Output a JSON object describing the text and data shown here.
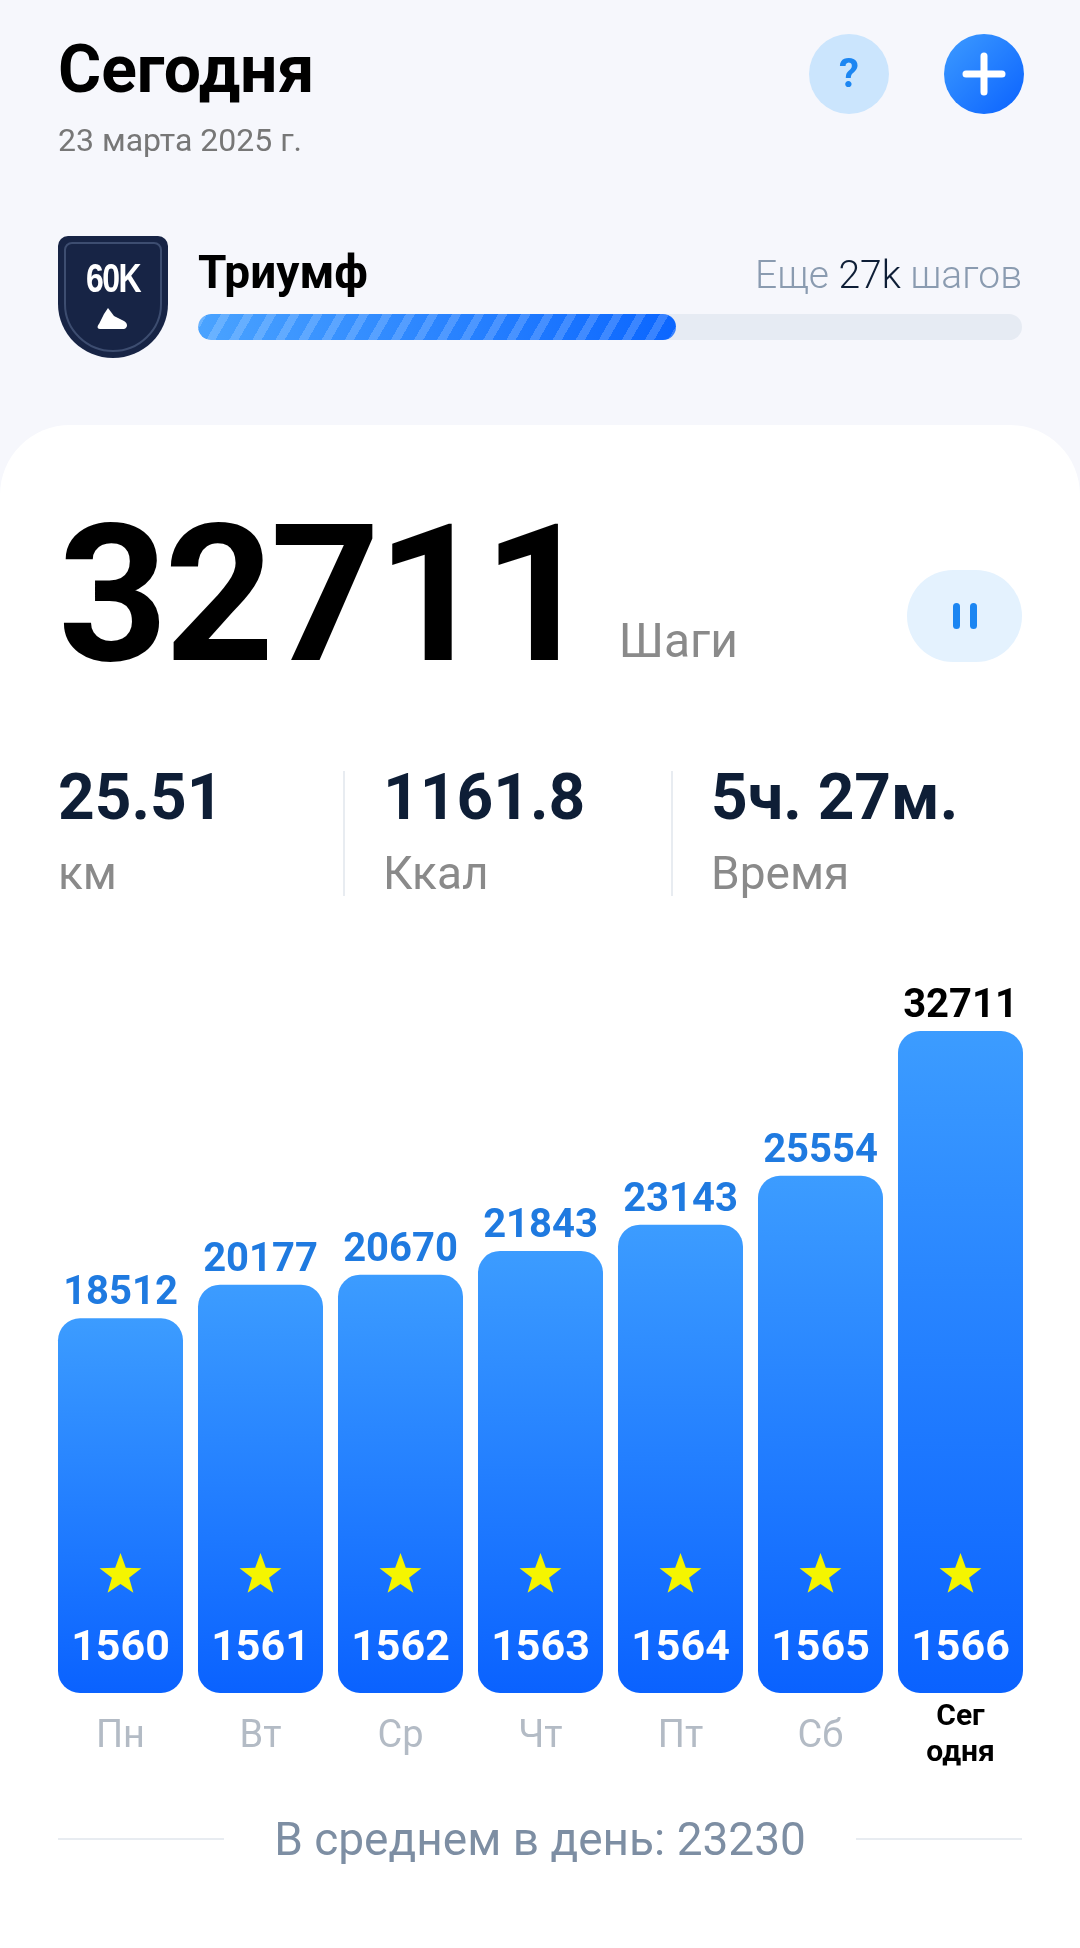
{
  "header": {
    "title": "Сегодня",
    "date": "23 марта 2025 г.",
    "help_label": "?"
  },
  "achievement": {
    "badge": "60K",
    "title": "Триумф",
    "remaining_prefix": "Еще",
    "remaining_value": "27k",
    "remaining_suffix": "шагов",
    "level": 0.58
  },
  "steps": {
    "value": "32711",
    "unit": "Шаги"
  },
  "stats": [
    {
      "value": "25.51",
      "label": "км"
    },
    {
      "value": "1161.8",
      "label": "Ккал"
    },
    {
      "value": "5ч. 27м.",
      "label": "Время"
    }
  ],
  "chart_data": {
    "type": "bar",
    "categories": [
      "Пн",
      "Вт",
      "Ср",
      "Чт",
      "Пт",
      "Сб",
      "Сегодня"
    ],
    "values": [
      18512,
      20177,
      20670,
      21843,
      23143,
      25554,
      32711
    ],
    "data_labels": true
  },
  "bars": [
    {
      "number": "1560",
      "star": true,
      "current": false
    },
    {
      "number": "1561",
      "star": true,
      "current": false
    },
    {
      "number": "1562",
      "star": true,
      "current": false
    },
    {
      "number": "1563",
      "star": true,
      "current": false
    },
    {
      "number": "1564",
      "star": true,
      "current": false
    },
    {
      "number": "1565",
      "star": true,
      "current": false
    },
    {
      "number": "1566",
      "star": true,
      "current": true
    }
  ],
  "average": "В среднем в день: 23230"
}
